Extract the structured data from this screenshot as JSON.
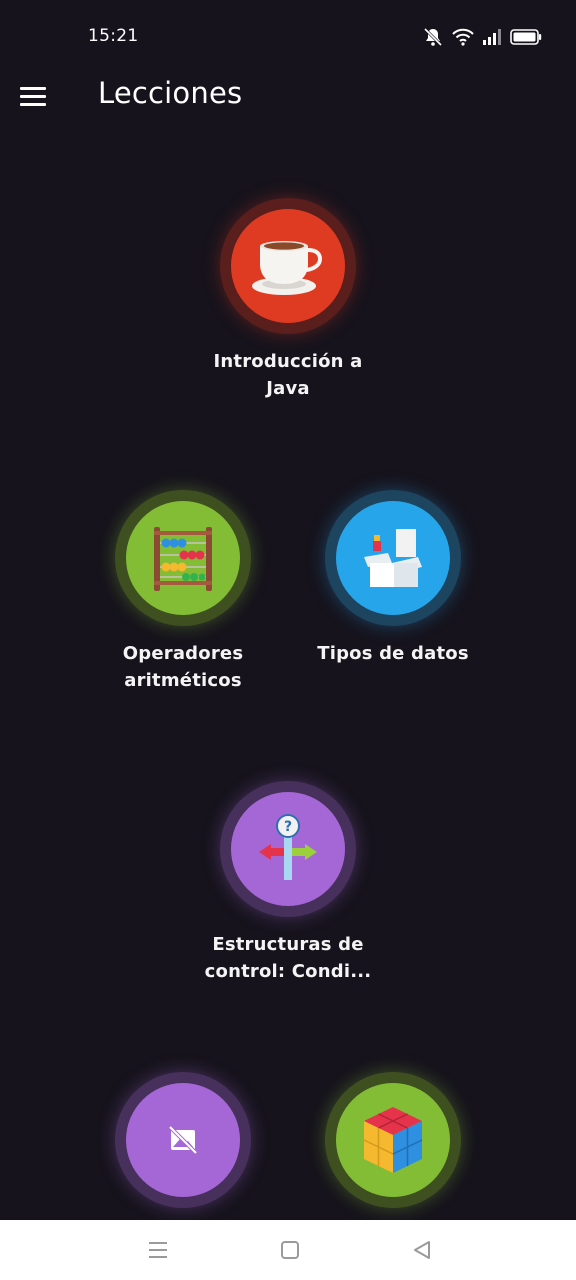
{
  "status_bar": {
    "time": "15:21",
    "icons": [
      "mute-icon",
      "wifi-icon",
      "signal-icon",
      "battery-icon"
    ]
  },
  "app_bar": {
    "menu_icon": "hamburger-menu-icon",
    "title": "Lecciones"
  },
  "lessons": [
    {
      "label_line1": "Introducción a",
      "label_line2": "Java",
      "icon": "coffee-cup-icon",
      "color": "#df3b22"
    },
    {
      "label_line1": "Operadores",
      "label_line2": "aritméticos",
      "icon": "abacus-icon",
      "color": "#82bd35"
    },
    {
      "label_line1": "Tipos de datos",
      "label_line2": "",
      "icon": "open-box-icon",
      "color": "#27a5ea"
    },
    {
      "label_line1": "Estructuras de",
      "label_line2": "control: Condi...",
      "icon": "signpost-question-icon",
      "color": "#a667d6"
    },
    {
      "label_line1": "",
      "label_line2": "",
      "icon": "image-off-icon",
      "color": "#a667d6"
    },
    {
      "label_line1": "",
      "label_line2": "",
      "icon": "rubik-cube-icon",
      "color": "#82bd35"
    }
  ],
  "nav_bar": {
    "buttons": [
      "recents-icon",
      "home-icon",
      "back-icon"
    ]
  }
}
